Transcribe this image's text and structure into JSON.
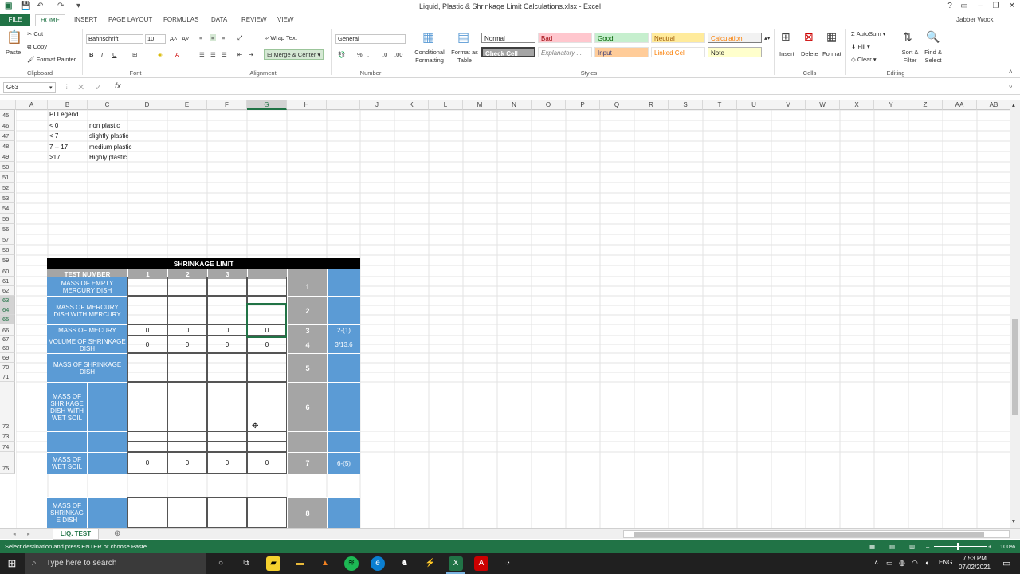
{
  "window": {
    "title": "Liquid, Plastic & Shrinkage Limit Calculations.xlsx - Excel",
    "user": "Jabber Wock"
  },
  "ribbon_tabs": [
    "FILE",
    "HOME",
    "INSERT",
    "PAGE LAYOUT",
    "FORMULAS",
    "DATA",
    "REVIEW",
    "VIEW"
  ],
  "clipboard": {
    "paste": "Paste",
    "cut": "Cut",
    "copy": "Copy",
    "format_painter": "Format Painter",
    "label": "Clipboard"
  },
  "font": {
    "name": "Bahnschrift",
    "size": "10",
    "label": "Font"
  },
  "alignment": {
    "wrap": "Wrap Text",
    "merge": "Merge & Center",
    "label": "Alignment"
  },
  "number": {
    "format": "General",
    "label": "Number"
  },
  "styles": {
    "conditional": "Conditional Formatting",
    "format_table": "Format as Table",
    "label": "Styles",
    "items": [
      "Normal",
      "Bad",
      "Good",
      "Neutral",
      "Calculation",
      "Check Cell",
      "Explanatory ...",
      "Input",
      "Linked Cell",
      "Note"
    ]
  },
  "cells": {
    "insert": "Insert",
    "delete": "Delete",
    "format": "Format",
    "label": "Cells"
  },
  "editing": {
    "autosum": "AutoSum",
    "fill": "Fill",
    "clear": "Clear",
    "sort": "Sort & Filter",
    "find": "Find & Select",
    "label": "Editing"
  },
  "formula_bar": {
    "name_box": "G63",
    "fx": "fx",
    "formula": ""
  },
  "columns": [
    "A",
    "B",
    "C",
    "D",
    "E",
    "F",
    "G",
    "H",
    "I",
    "J",
    "K",
    "L",
    "M",
    "N",
    "O",
    "P",
    "Q",
    "R",
    "S",
    "T",
    "U",
    "V",
    "W",
    "X",
    "Y",
    "Z",
    "AA",
    "AB"
  ],
  "rows": [
    "45",
    "46",
    "47",
    "48",
    "49",
    "50",
    "51",
    "52",
    "53",
    "54",
    "55",
    "56",
    "57",
    "58",
    "59",
    "60",
    "61",
    "62",
    "63",
    "64",
    "65",
    "66",
    "67",
    "68",
    "69",
    "70",
    "71",
    "72",
    "73",
    "74",
    "75"
  ],
  "pi_legend": {
    "title": "PI Legend",
    "entries": [
      {
        "range": "< 0",
        "desc": "non plastic"
      },
      {
        "range": "< 7",
        "desc": "slightly plastic"
      },
      {
        "range": "7 -- 17",
        "desc": "medium plastic"
      },
      {
        "range": ">17",
        "desc": "Highly plastic"
      }
    ]
  },
  "shrinkage": {
    "title": "SHRINKAGE LIMIT",
    "test_number": "TEST NUMBER",
    "tests": [
      "1",
      "2",
      "3",
      ""
    ],
    "rows": [
      {
        "label": "MASS OF EMPTY MERCURY DISH",
        "vals": [
          "",
          "",
          "",
          ""
        ],
        "step": "1",
        "formula": ""
      },
      {
        "label": "MASS OF MERCURY DISH WITH MERCURY",
        "vals": [
          "",
          "",
          "",
          ""
        ],
        "step": "2",
        "formula": ""
      },
      {
        "label": "MASS OF MECURY",
        "vals": [
          "0",
          "0",
          "0",
          "0"
        ],
        "step": "3",
        "formula": "2-(1)"
      },
      {
        "label": "VOLUME OF SHRINKAGE DISH",
        "vals": [
          "0",
          "0",
          "0",
          "0"
        ],
        "step": "4",
        "formula": "3/13.6"
      },
      {
        "label": "MASS OF SHRINKAGE DISH",
        "vals": [
          "",
          "",
          "",
          ""
        ],
        "step": "5",
        "formula": ""
      },
      {
        "label": "MASS OF SHRIKAGE DISH WITH WET SOIL",
        "vals": [
          "",
          "",
          "",
          ""
        ],
        "step": "6",
        "formula": ""
      },
      {
        "label": "MASS OF WET SOIL",
        "vals": [
          "0",
          "0",
          "0",
          "0"
        ],
        "step": "7",
        "formula": "6-(5)"
      },
      {
        "label": "MASS OF SHRINKAG E DISH",
        "vals": [
          "",
          "",
          "",
          ""
        ],
        "step": "8",
        "formula": ""
      }
    ]
  },
  "sheet_tab": "LIQ. TEST",
  "status": {
    "message": "Select destination and press ENTER or choose Paste",
    "zoom": "100%"
  },
  "taskbar": {
    "search": "Type here to search",
    "time": "7:53 PM",
    "date": "07/02/2021",
    "lang": "ENG"
  }
}
